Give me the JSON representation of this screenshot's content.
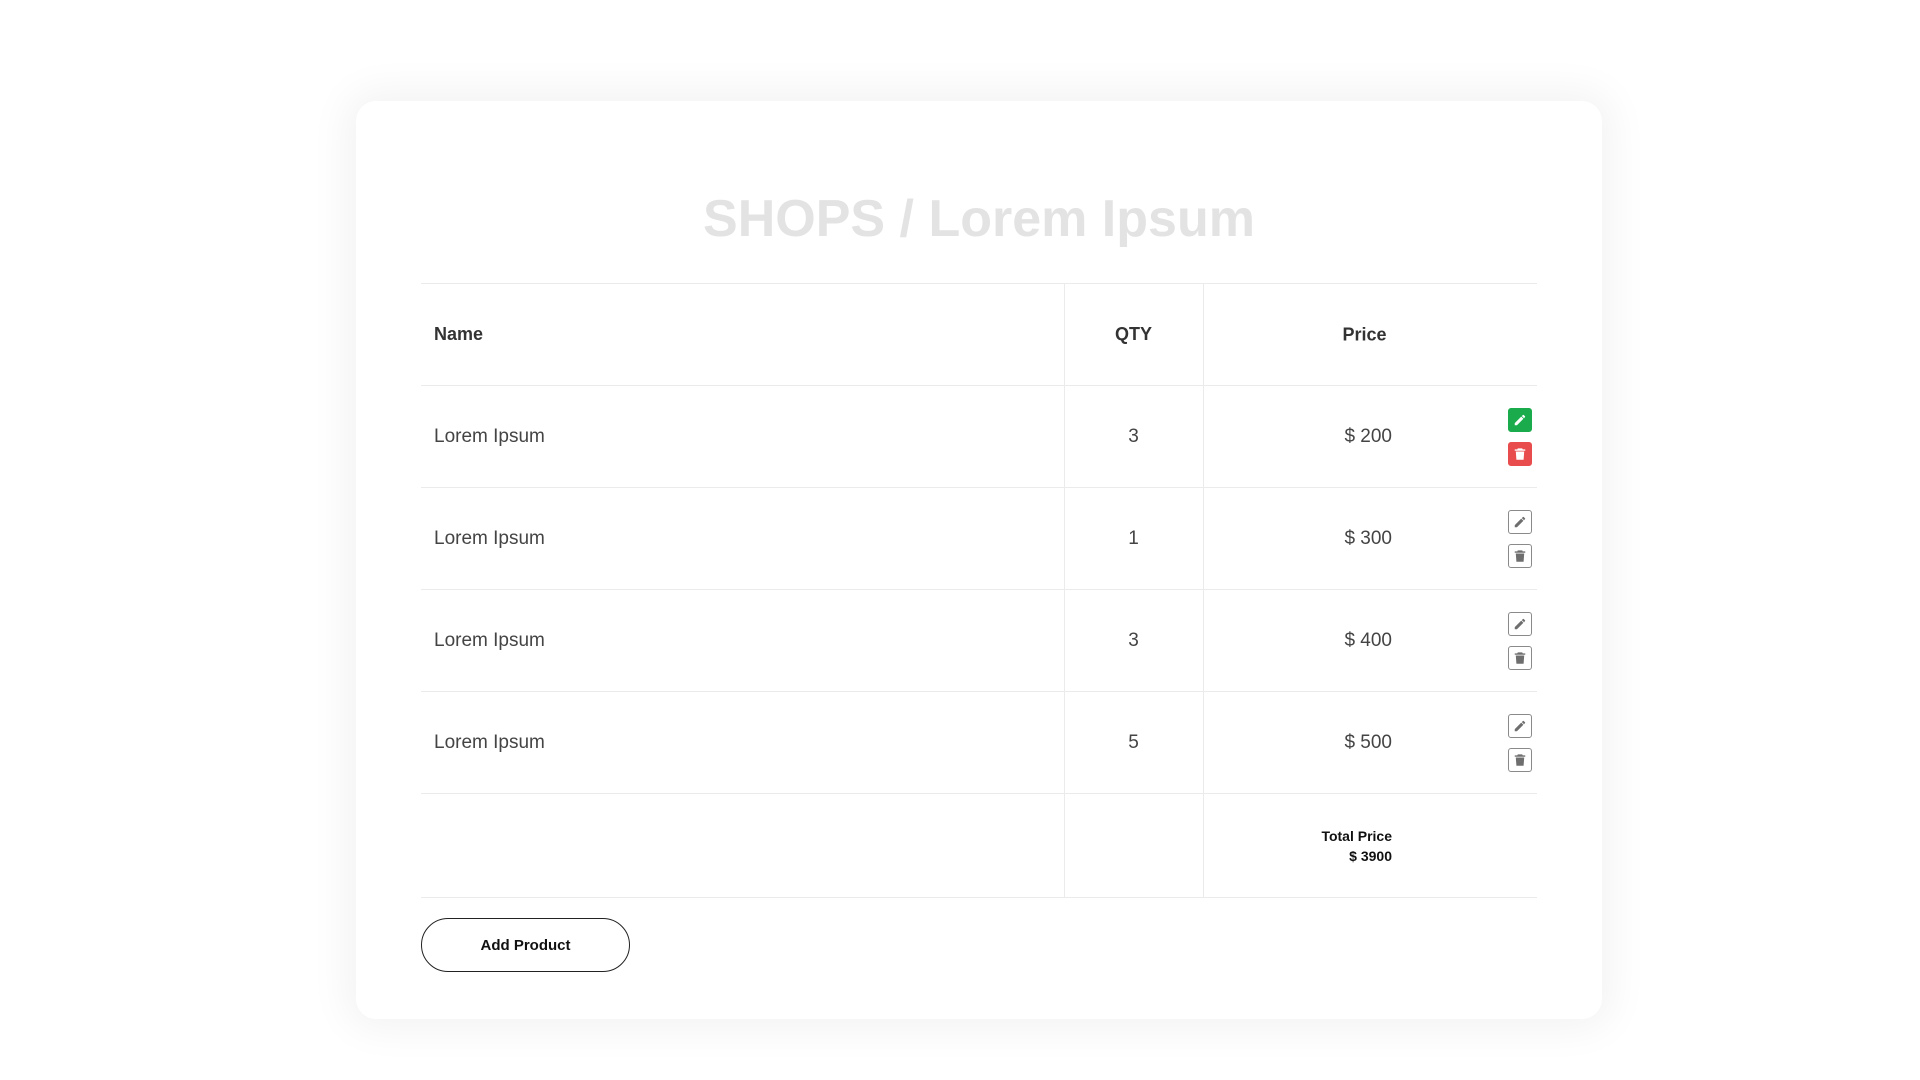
{
  "page": {
    "title": "SHOPS / Lorem Ipsum"
  },
  "table": {
    "headers": {
      "name": "Name",
      "qty": "QTY",
      "price": "Price"
    },
    "rows": [
      {
        "name": "Lorem Ipsum",
        "qty": "3",
        "price": "$ 200",
        "actions_state": "active"
      },
      {
        "name": "Lorem Ipsum",
        "qty": "1",
        "price": "$ 300",
        "actions_state": "inactive"
      },
      {
        "name": "Lorem Ipsum",
        "qty": "3",
        "price": "$ 400",
        "actions_state": "inactive"
      },
      {
        "name": "Lorem Ipsum",
        "qty": "5",
        "price": "$ 500",
        "actions_state": "inactive"
      }
    ],
    "total": {
      "label": "Total Price",
      "value": "$ 3900"
    }
  },
  "actions": {
    "add_product_label": "Add Product"
  },
  "icons": {
    "edit": "pencil-icon",
    "delete": "trash-icon"
  },
  "colors": {
    "edit_active": "#1aac4c",
    "delete_active": "#e84c4c",
    "title": "#e3e3e3"
  }
}
